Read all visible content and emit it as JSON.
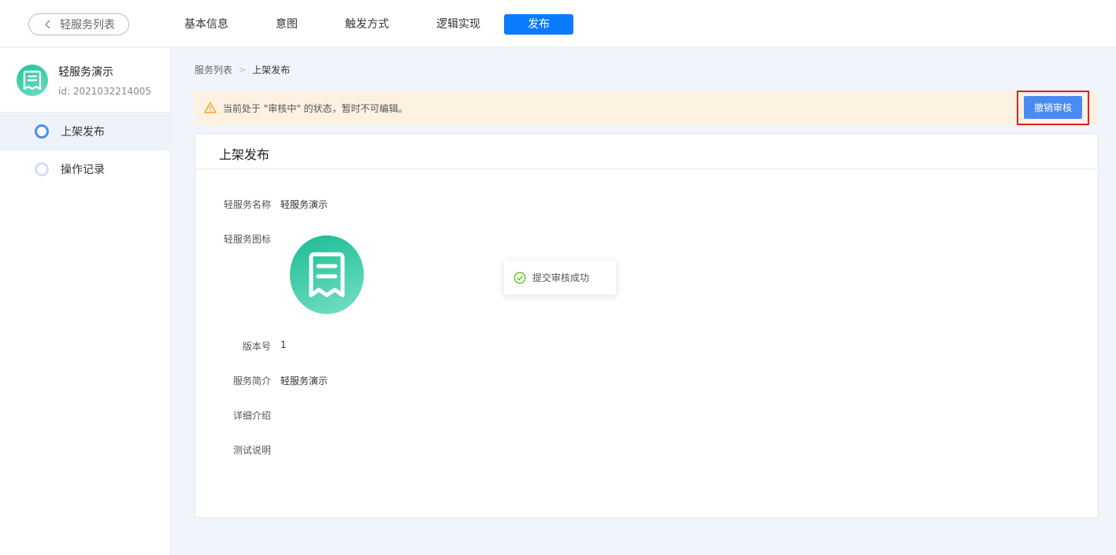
{
  "header": {
    "back_label": "轻服务列表",
    "tabs": [
      {
        "label": "基本信息"
      },
      {
        "label": "意图"
      },
      {
        "label": "触发方式"
      },
      {
        "label": "逻辑实现"
      },
      {
        "label": "发布"
      }
    ],
    "active_tab": "发布"
  },
  "sidebar": {
    "service_name": "轻服务演示",
    "service_id": "id: 2021032214005",
    "items": [
      {
        "label": "上架发布"
      },
      {
        "label": "操作记录"
      }
    ]
  },
  "breadcrumb": {
    "parent": "服务列表",
    "separator": ">",
    "current": "上架发布"
  },
  "notice": {
    "text": "当前处于 \"审核中\" 的状态，暂时不可编辑。",
    "button_label": "撤销审核"
  },
  "card": {
    "title": "上架发布",
    "fields": {
      "name_label": "轻服务名称",
      "name_value": "轻服务演示",
      "icon_label": "轻服务图标",
      "version_label": "版本号",
      "version_value": "1",
      "intro_label": "服务简介",
      "intro_value": "轻服务演示",
      "detail_label": "详细介绍",
      "test_label": "测试说明"
    }
  },
  "toast": {
    "message": "提交审核成功"
  },
  "colors": {
    "primary": "#0a7bff",
    "button": "#4a8af4",
    "warning_bg": "#fdf1e2",
    "warning_icon": "#f5a623",
    "success": "#52c41a",
    "highlight": "#e02020",
    "icon_gradient_start": "#19bb94",
    "icon_gradient_end": "#78e0c4"
  },
  "icons": {
    "back": "chevron-left-icon",
    "warning": "warning-triangle-icon",
    "success": "check-circle-icon",
    "service": "document-note-icon"
  }
}
